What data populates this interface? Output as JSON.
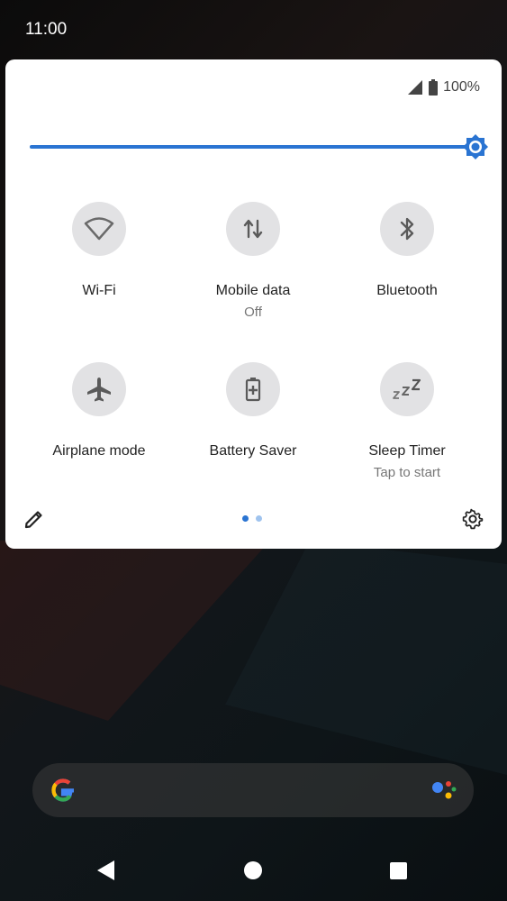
{
  "status_bar": {
    "time": "11:00"
  },
  "quick_settings": {
    "battery_percent": "100%",
    "brightness": {
      "level": 1.0,
      "accent": "#2a74d2"
    },
    "tiles": [
      {
        "label": "Wi-Fi",
        "sub": "",
        "icon": "wifi-icon"
      },
      {
        "label": "Mobile data",
        "sub": "Off",
        "icon": "mobile-data-icon"
      },
      {
        "label": "Bluetooth",
        "sub": "",
        "icon": "bluetooth-icon"
      },
      {
        "label": "Airplane mode",
        "sub": "",
        "icon": "airplane-icon"
      },
      {
        "label": "Battery Saver",
        "sub": "",
        "icon": "battery-saver-icon"
      },
      {
        "label": "Sleep Timer",
        "sub": "Tap to start",
        "icon": "sleep-icon"
      }
    ],
    "page_indicator": {
      "current": 1,
      "total": 2
    }
  },
  "colors": {
    "accent": "#2a74d2",
    "tile_bg": "#e2e2e4",
    "panel_bg": "#ffffff"
  }
}
